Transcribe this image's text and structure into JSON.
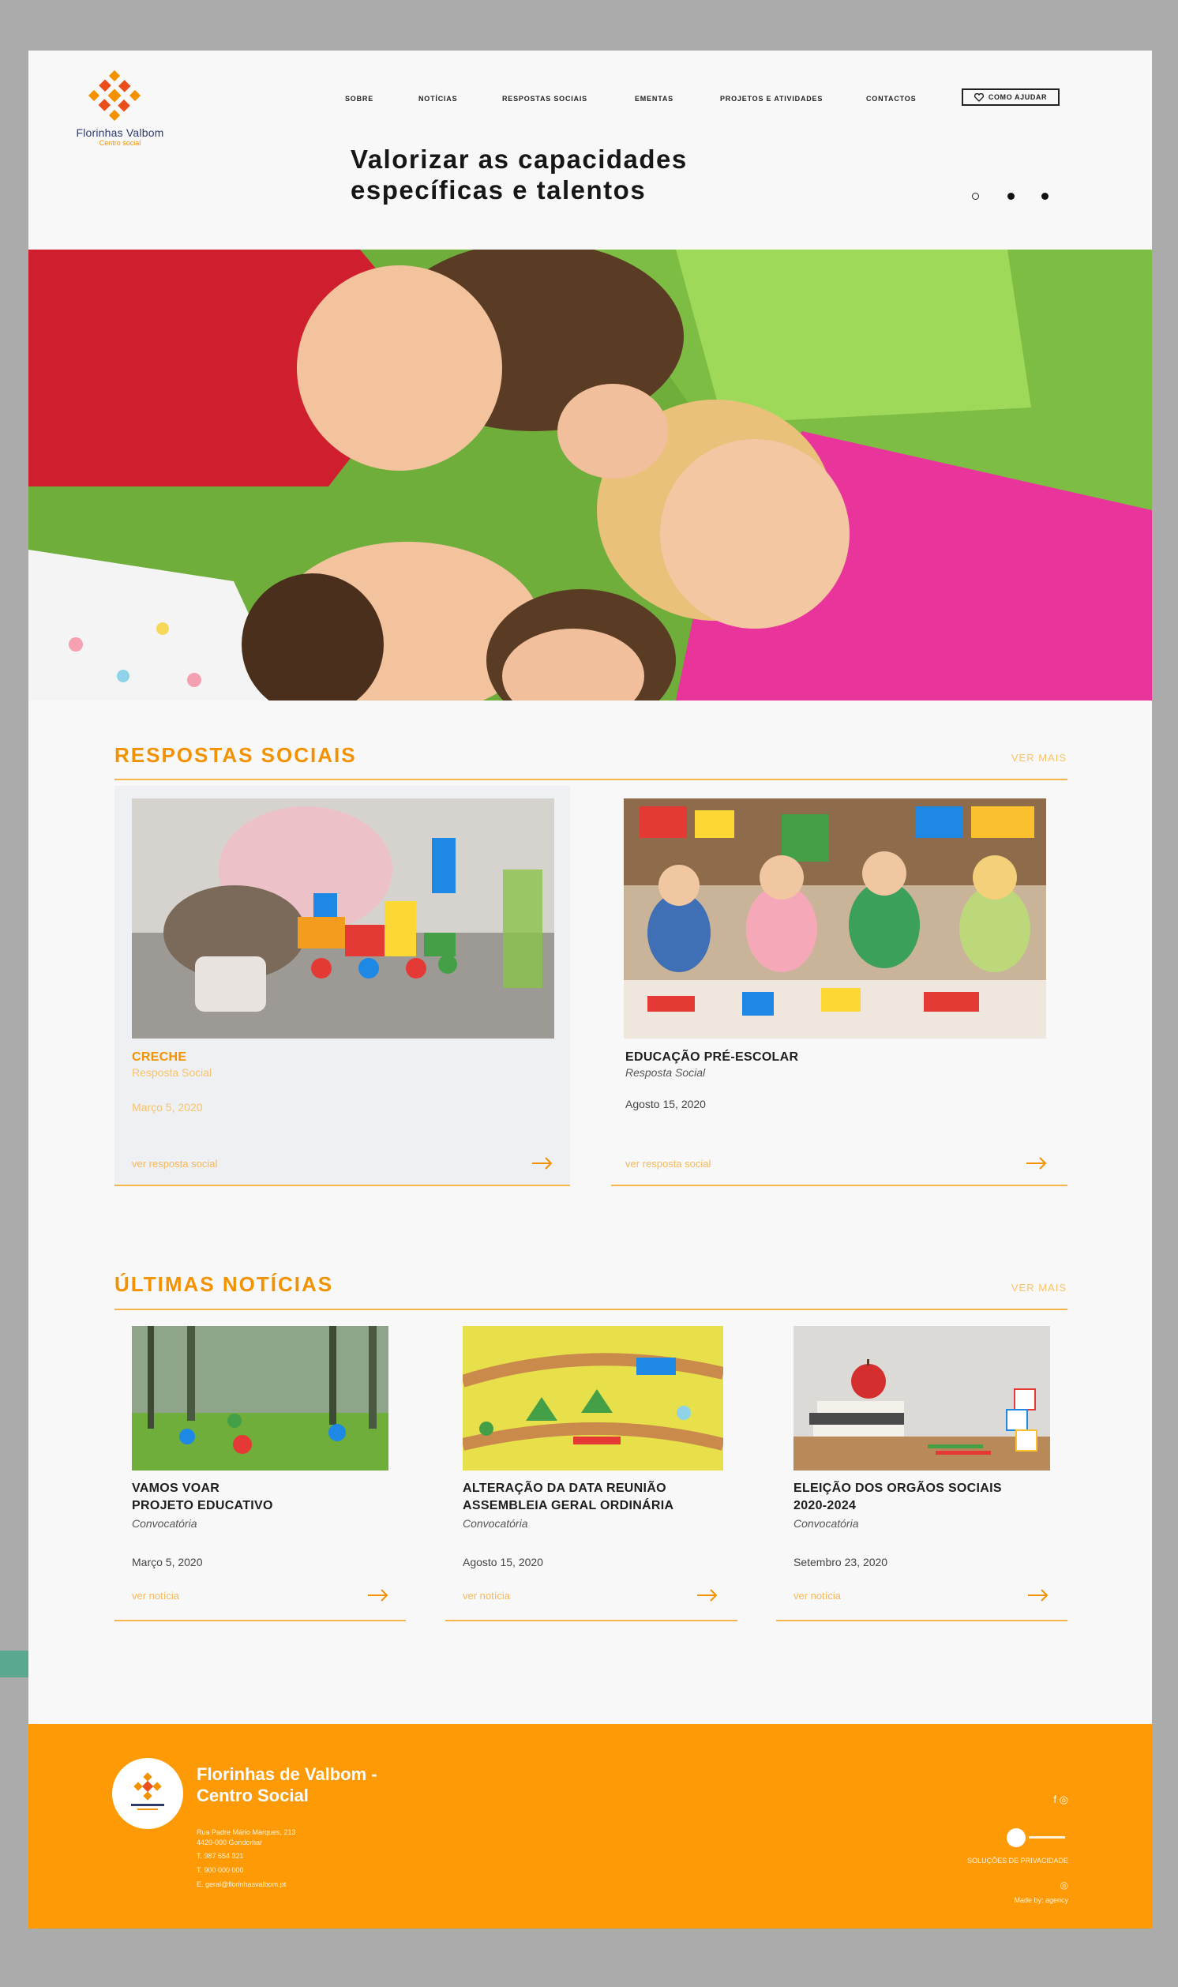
{
  "brand": {
    "name": "Florinhas Valbom",
    "subtitle": "Centro social"
  },
  "nav": {
    "items": [
      "SOBRE",
      "NOTÍCIAS",
      "RESPOSTAS SOCIAIS",
      "EMENTAS",
      "PROJETOS E ATIVIDADES",
      "CONTACTOS"
    ],
    "help_label": "COMO AJUDAR"
  },
  "hero": {
    "headline_line1": "Valorizar as capacidades",
    "headline_line2": "específicas e talentos"
  },
  "respostas": {
    "title": "RESPOSTAS SOCIAIS",
    "ver_mais": "VER MAIS",
    "cards": [
      {
        "title": "CRECHE",
        "category": "Resposta Social",
        "date": "Março 5, 2020",
        "link": "ver resposta social"
      },
      {
        "title": "EDUCAÇÃO PRÉ-ESCOLAR",
        "category": "Resposta Social",
        "date": "Agosto 15, 2020",
        "link": "ver resposta social"
      }
    ]
  },
  "noticias": {
    "title": "ÚLTIMAS NOTÍCIAS",
    "ver_mais": "VER MAIS",
    "cards": [
      {
        "title_line1": "VAMOS VOAR",
        "title_line2": "PROJETO EDUCATIVO",
        "category": "Convocatória",
        "date": "Março 5, 2020",
        "link": "ver notícia"
      },
      {
        "title_line1": "ALTERAÇÃO DA DATA REUNIÃO",
        "title_line2": "ASSEMBLEIA GERAL ORDINÁRIA",
        "category": "Convocatória",
        "date": "Agosto 15, 2020",
        "link": "ver notícia"
      },
      {
        "title_line1": "ELEIÇÃO DOS ORGÃOS SOCIAIS",
        "title_line2": "2020-2024",
        "category": "Convocatória",
        "date": "Setembro 23, 2020",
        "link": "ver notícia"
      }
    ]
  },
  "footer": {
    "name_line1": "Florinhas de Valbom -",
    "name_line2": "Centro Social",
    "address1": "Rua Padre Mário Marques, 213",
    "address2": "4420-000 Gondomar",
    "phone1": "T. 987 654 321",
    "phone2": "T. 900 000 000",
    "email": "E. geral@florinhasvalbom.pt",
    "social": "f  ◎",
    "partner": "SOLUÇÕES DE PRIVACIDADE",
    "credit": "Made by: agency"
  },
  "colors": {
    "accent": "#f39200",
    "footer": "#fd9a06",
    "frame": "#ababab"
  }
}
